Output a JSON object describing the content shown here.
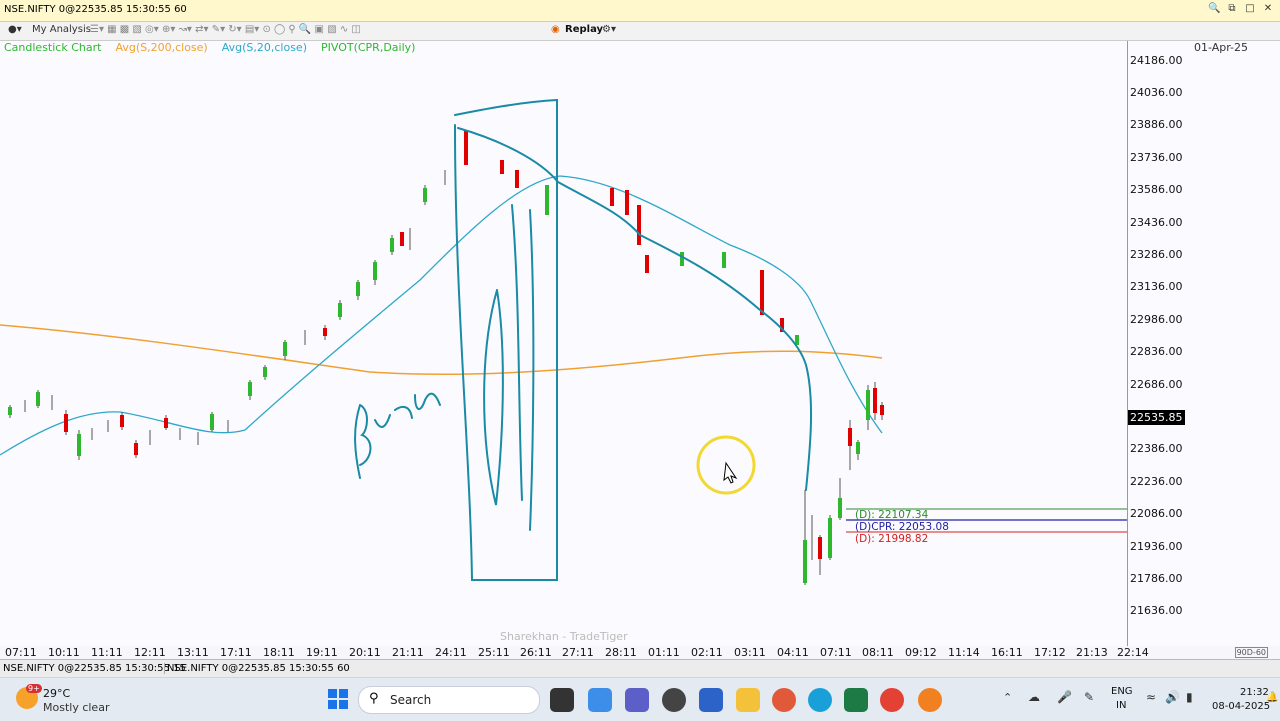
{
  "window": {
    "title": "NSE.NIFTY 0@22535.85 15:30:55 60"
  },
  "toolbar": {
    "my_analysis": "My Analysis",
    "replay": "Replay"
  },
  "legend": {
    "items": [
      {
        "label": "Candlestick Chart",
        "color": "#2eb82e"
      },
      {
        "label": "Avg(S,200,close)",
        "color": "#f0a030"
      },
      {
        "label": "Avg(S,20,close)",
        "color": "#2ea8c8"
      },
      {
        "label": "PIVOT(CPR,Daily)",
        "color": "#2eb82e"
      }
    ]
  },
  "chart": {
    "date_label": "01-Apr-25",
    "current_price": "22535.85",
    "y_ticks": [
      "24186.00",
      "24036.00",
      "23886.00",
      "23736.00",
      "23586.00",
      "23436.00",
      "23286.00",
      "23136.00",
      "22986.00",
      "22836.00",
      "22686.00",
      "22386.00",
      "22236.00",
      "22086.00",
      "21936.00",
      "21786.00",
      "21636.00"
    ],
    "x_ticks": [
      "07:11",
      "10:11",
      "11:11",
      "12:11",
      "13:11",
      "17:11",
      "18:11",
      "19:11",
      "20:11",
      "21:11",
      "24:11",
      "25:11",
      "26:11",
      "27:11",
      "28:11",
      "01:11",
      "02:11",
      "03:11",
      "04:11",
      "07:11",
      "08:11",
      "09:12",
      "11:14",
      "16:11",
      "17:12",
      "21:13",
      "22:14"
    ],
    "pivot_labels": {
      "r": "(D): 22107.34",
      "cpr": "(D)CPR: 22053.08",
      "s": "(D): 21998.82"
    },
    "watermark": "Sharekhan - TradeTiger",
    "range_tag": "90D-60"
  },
  "chart_data": {
    "type": "line",
    "title": "",
    "series": [
      {
        "name": "Avg(S,200,close)",
        "values": [
          22986,
          22836,
          22800,
          22810,
          22840,
          22836
        ]
      },
      {
        "name": "Avg(S,20,close)",
        "values": [
          22400,
          22450,
          22800,
          23400,
          23586,
          23300,
          22500
        ]
      }
    ],
    "ylim": [
      21636,
      24186
    ]
  },
  "status": {
    "left1": "NSE.NIFTY 0@22535.85 15:30:55 15",
    "left2": "NSE.NIFTY 0@22535.85 15:30:55 60"
  },
  "taskbar": {
    "weather_temp": "29°C",
    "weather_desc": "Mostly clear",
    "search": "Search",
    "lang1": "ENG",
    "lang2": "IN",
    "time": "21:32",
    "date": "08-04-2025",
    "badge": "9+"
  }
}
